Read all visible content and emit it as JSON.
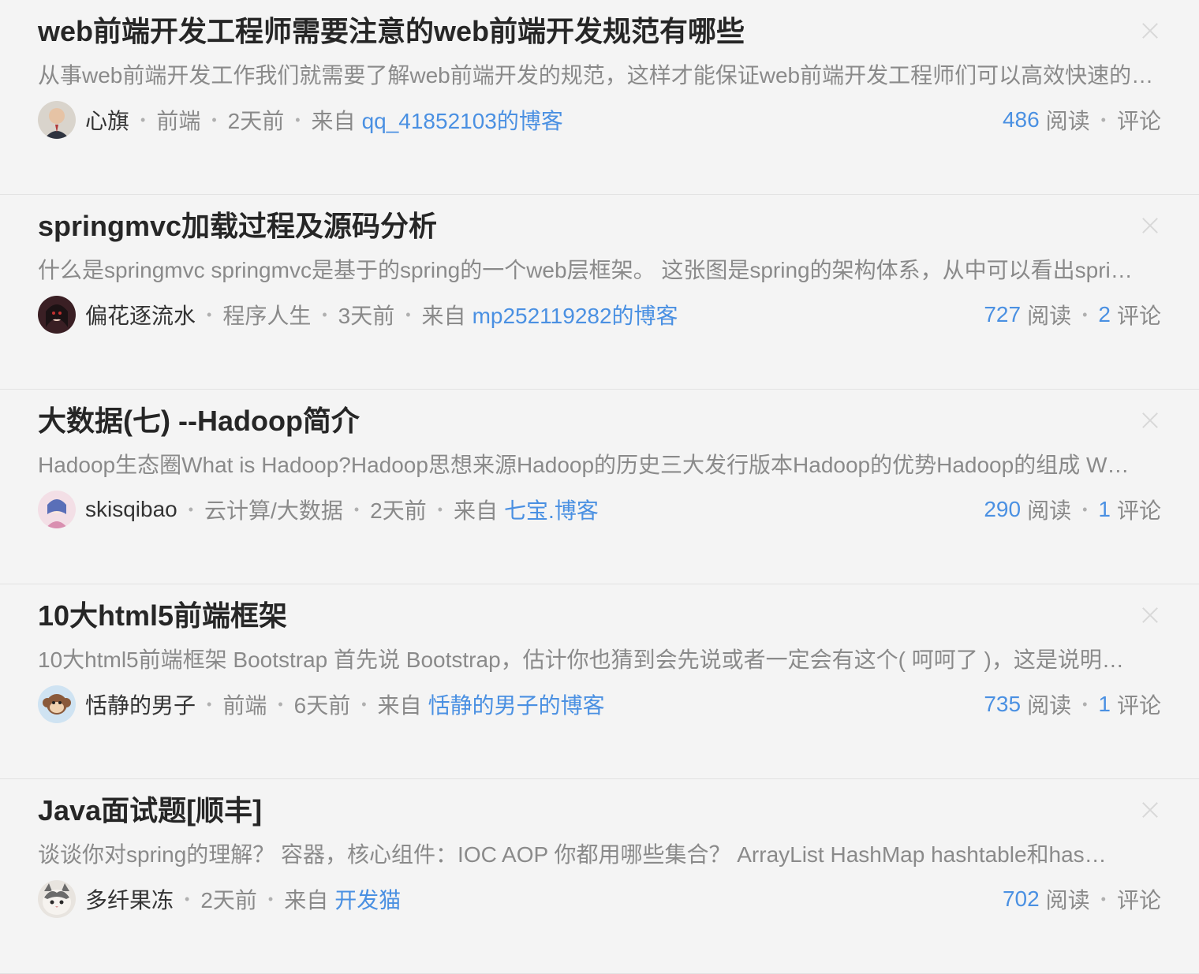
{
  "articles": [
    {
      "title": "web前端开发工程师需要注意的web前端开发规范有哪些",
      "summary": "从事web前端开发工作我们就需要了解web前端开发的规范，这样才能保证web前端开发工程师们可以高效快速的…",
      "author": "心旗",
      "tag": "前端",
      "time": "2天前",
      "source_prefix": "来自",
      "source": "qq_41852103的博客",
      "reads": "486",
      "reads_label": "阅读",
      "comments": "",
      "comments_label": "评论",
      "avatar_color": "#3b3f4a"
    },
    {
      "title": "springmvc加载过程及源码分析",
      "summary": "什么是springmvc springmvc是基于的spring的一个web层框架。 这张图是spring的架构体系，从中可以看出spri…",
      "author": "偏花逐流水",
      "tag": "程序人生",
      "time": "3天前",
      "source_prefix": "来自",
      "source": "mp252119282的博客",
      "reads": "727",
      "reads_label": "阅读",
      "comments": "2",
      "comments_label": "评论",
      "avatar_color": "#7a2e2e"
    },
    {
      "title": "大数据(七) --Hadoop简介",
      "summary": "Hadoop生态圈What is Hadoop?Hadoop思想来源Hadoop的历史三大发行版本Hadoop的优势Hadoop的组成 W…",
      "author": "skisqibao",
      "tag": "云计算/大数据",
      "time": "2天前",
      "source_prefix": "来自",
      "source": "七宝.博客",
      "reads": "290",
      "reads_label": "阅读",
      "comments": "1",
      "comments_label": "评论",
      "avatar_color": "#e9b6c8"
    },
    {
      "title": "10大html5前端框架",
      "summary": "10大html5前端框架 Bootstrap 首先说 Bootstrap，估计你也猜到会先说或者一定会有这个( 呵呵了 )，这是说明…",
      "author": "恬静的男子",
      "tag": "前端",
      "time": "6天前",
      "source_prefix": "来自",
      "source": "恬静的男子的博客",
      "reads": "735",
      "reads_label": "阅读",
      "comments": "1",
      "comments_label": "评论",
      "avatar_color": "#6fa8d6"
    },
    {
      "title": "Java面试题[顺丰]",
      "summary": "谈谈你对spring的理解？ 容器，核心组件：IOC AOP  你都用哪些集合？ ArrayList HashMap  hashtable和has…",
      "author": "多纤果冻",
      "tag": "",
      "time": "2天前",
      "source_prefix": "来自",
      "source": "开发猫",
      "reads": "702",
      "reads_label": "阅读",
      "comments": "",
      "comments_label": "评论",
      "avatar_color": "#8c8c8c"
    }
  ]
}
